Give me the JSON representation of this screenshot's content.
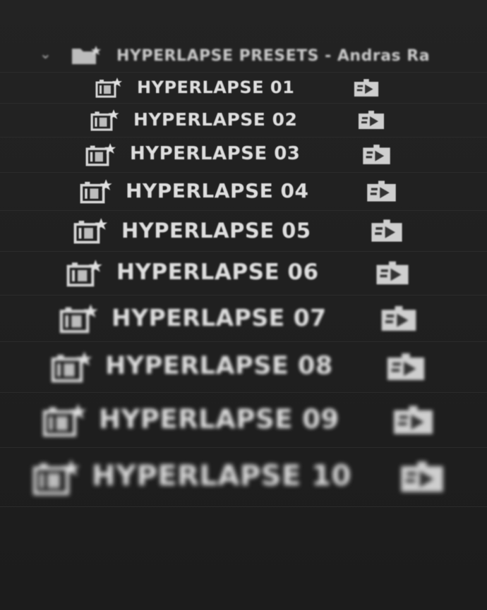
{
  "bin": {
    "label": "HYPERLAPSE PRESETS - Andras Ra",
    "expanded": true,
    "chevron_icon": "chevron-down-icon",
    "folder_icon": "bin-folder-icon"
  },
  "items": [
    {
      "label": "HYPERLAPSE 01",
      "icon": "preset-sequence-star-icon",
      "type_icon": "sequence-icon"
    },
    {
      "label": "HYPERLAPSE 02",
      "icon": "preset-sequence-star-icon",
      "type_icon": "sequence-icon"
    },
    {
      "label": "HYPERLAPSE 03",
      "icon": "preset-sequence-star-icon",
      "type_icon": "sequence-icon"
    },
    {
      "label": "HYPERLAPSE 04",
      "icon": "preset-sequence-star-icon",
      "type_icon": "sequence-icon"
    },
    {
      "label": "HYPERLAPSE 05",
      "icon": "preset-sequence-star-icon",
      "type_icon": "sequence-icon"
    },
    {
      "label": "HYPERLAPSE 06",
      "icon": "preset-sequence-star-icon",
      "type_icon": "sequence-icon"
    },
    {
      "label": "HYPERLAPSE 07",
      "icon": "preset-sequence-star-icon",
      "type_icon": "sequence-icon"
    },
    {
      "label": "HYPERLAPSE 08",
      "icon": "preset-sequence-star-icon",
      "type_icon": "sequence-icon"
    },
    {
      "label": "HYPERLAPSE 09",
      "icon": "preset-sequence-star-icon",
      "type_icon": "sequence-icon"
    },
    {
      "label": "HYPERLAPSE 10",
      "icon": "preset-sequence-star-icon",
      "type_icon": "sequence-icon"
    }
  ],
  "colors": {
    "background": "#1f1f1f",
    "text": "#dedede",
    "icon": "#d0d0d0"
  }
}
